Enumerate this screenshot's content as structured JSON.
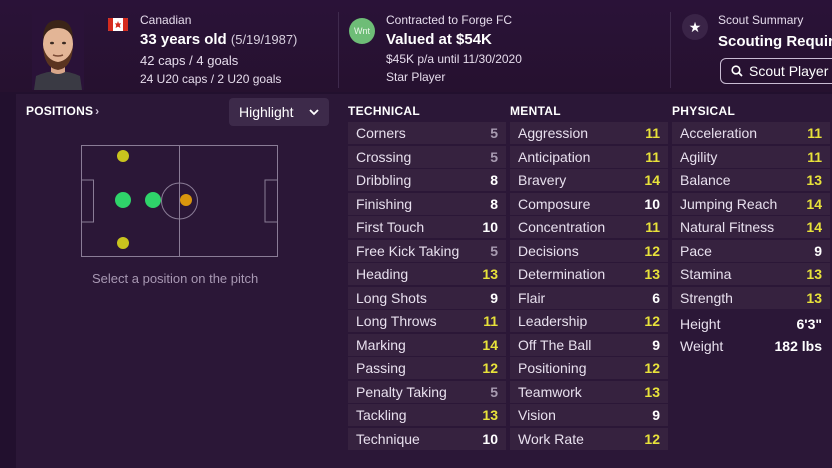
{
  "header": {
    "nationality": "Canadian",
    "age": "33 years old",
    "dob": "(5/19/1987)",
    "caps": "42 caps / 4 goals",
    "u20": "24 U20 caps / 2 U20 goals",
    "contract_badge": "Wnt",
    "contract": "Contracted to Forge FC",
    "value": "Valued at $54K",
    "wage": "$45K p/a until 11/30/2020",
    "status": "Star Player",
    "scout_title": "Scout Summary",
    "scout_status": "Scouting Required",
    "scout_button": "Scout Player"
  },
  "positions": {
    "title": "POSITIONS",
    "dropdown": "Highlight",
    "hint": "Select a position on the pitch"
  },
  "colors": {
    "grey": "#a89bb1",
    "white": "#ffffff",
    "yellow": "#e8e23a",
    "green": "#2fd36a",
    "yellow_dot": "#c9c41e",
    "orange_dot": "#d9960d"
  },
  "technical": {
    "title": "TECHNICAL",
    "rows": [
      {
        "name": "Corners",
        "value": "5"
      },
      {
        "name": "Crossing",
        "value": "5"
      },
      {
        "name": "Dribbling",
        "value": "8"
      },
      {
        "name": "Finishing",
        "value": "8"
      },
      {
        "name": "First Touch",
        "value": "10"
      },
      {
        "name": "Free Kick Taking",
        "value": "5"
      },
      {
        "name": "Heading",
        "value": "13"
      },
      {
        "name": "Long Shots",
        "value": "9"
      },
      {
        "name": "Long Throws",
        "value": "11"
      },
      {
        "name": "Marking",
        "value": "14"
      },
      {
        "name": "Passing",
        "value": "12"
      },
      {
        "name": "Penalty Taking",
        "value": "5"
      },
      {
        "name": "Tackling",
        "value": "13"
      },
      {
        "name": "Technique",
        "value": "10"
      }
    ]
  },
  "mental": {
    "title": "MENTAL",
    "rows": [
      {
        "name": "Aggression",
        "value": "11"
      },
      {
        "name": "Anticipation",
        "value": "11"
      },
      {
        "name": "Bravery",
        "value": "14"
      },
      {
        "name": "Composure",
        "value": "10"
      },
      {
        "name": "Concentration",
        "value": "11"
      },
      {
        "name": "Decisions",
        "value": "12"
      },
      {
        "name": "Determination",
        "value": "13"
      },
      {
        "name": "Flair",
        "value": "6"
      },
      {
        "name": "Leadership",
        "value": "12"
      },
      {
        "name": "Off The Ball",
        "value": "9"
      },
      {
        "name": "Positioning",
        "value": "12"
      },
      {
        "name": "Teamwork",
        "value": "13"
      },
      {
        "name": "Vision",
        "value": "9"
      },
      {
        "name": "Work Rate",
        "value": "12"
      }
    ]
  },
  "physical": {
    "title": "PHYSICAL",
    "rows": [
      {
        "name": "Acceleration",
        "value": "11"
      },
      {
        "name": "Agility",
        "value": "11"
      },
      {
        "name": "Balance",
        "value": "13"
      },
      {
        "name": "Jumping Reach",
        "value": "14"
      },
      {
        "name": "Natural Fitness",
        "value": "14"
      },
      {
        "name": "Pace",
        "value": "9"
      },
      {
        "name": "Stamina",
        "value": "13"
      },
      {
        "name": "Strength",
        "value": "13"
      }
    ],
    "height_label": "Height",
    "height": "6'3\"",
    "weight_label": "Weight",
    "weight": "182 lbs"
  }
}
